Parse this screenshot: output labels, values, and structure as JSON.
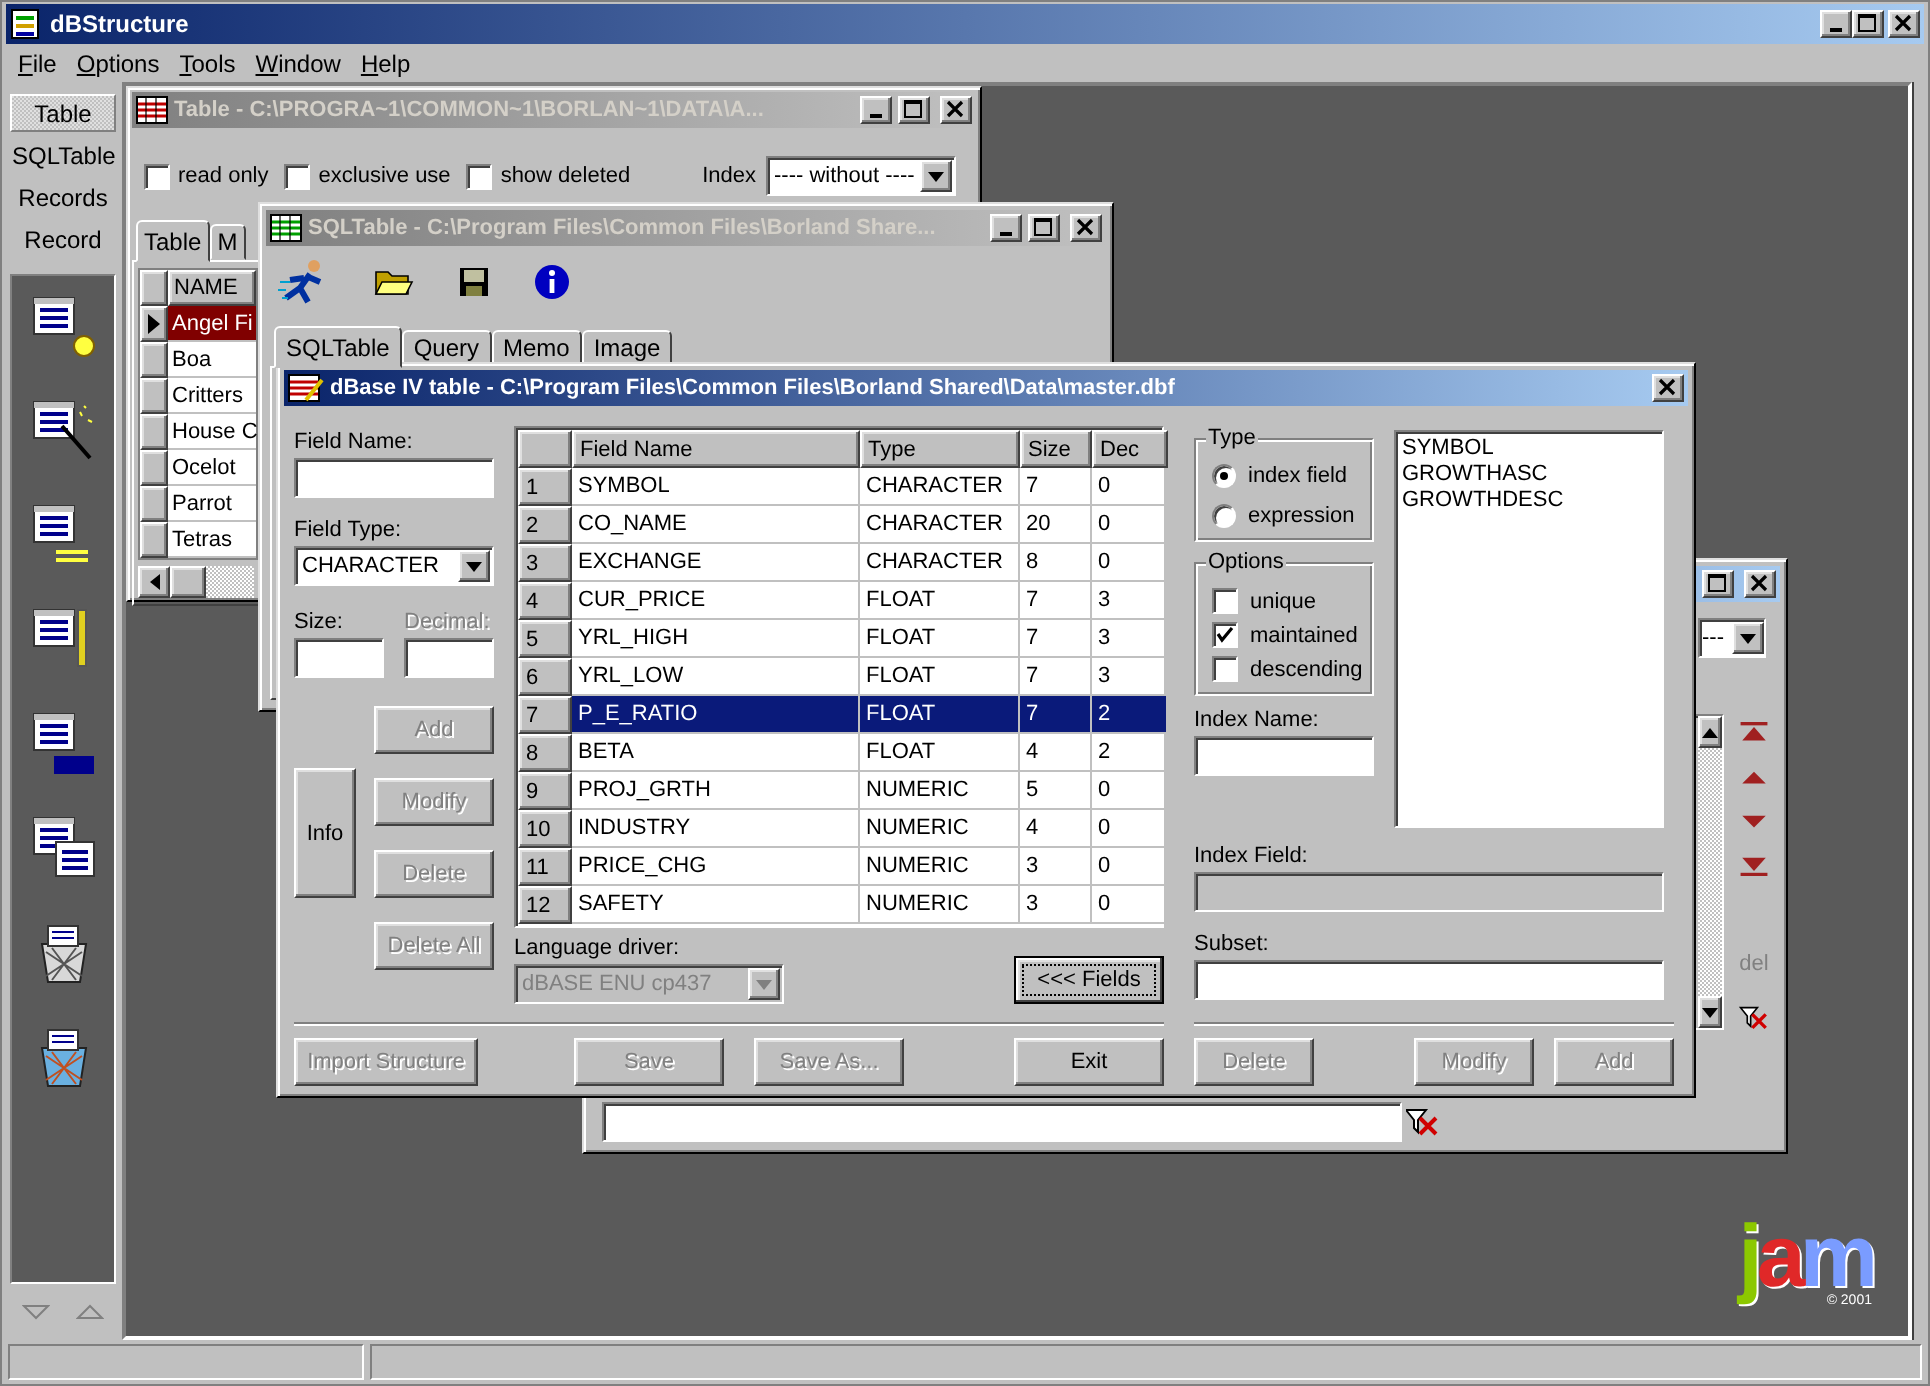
{
  "app": {
    "title": "dBStructure"
  },
  "menu": [
    {
      "label": "File"
    },
    {
      "label": "Options"
    },
    {
      "label": "Tools"
    },
    {
      "label": "Window"
    },
    {
      "label": "Help"
    }
  ],
  "sidebar": {
    "views": [
      {
        "label": "Table",
        "selected": true
      },
      {
        "label": "SQLTable",
        "selected": false
      },
      {
        "label": "Records",
        "selected": false
      },
      {
        "label": "Record",
        "selected": false
      }
    ]
  },
  "table_window": {
    "title": "Table - C:\\PROGRA~1\\COMMON~1\\BORLAN~1\\DATA\\A...",
    "options": [
      {
        "label": "read only",
        "checked": false
      },
      {
        "label": "exclusive use",
        "checked": false
      },
      {
        "label": "show deleted",
        "checked": false
      }
    ],
    "index": {
      "label": "Index",
      "value": "---- without ----"
    },
    "tabs": [
      {
        "label": "Table",
        "selected": true
      },
      {
        "label": "M",
        "selected": false
      }
    ],
    "grid": {
      "column": "NAME",
      "rows": [
        {
          "name": "Angel Fi",
          "selected": true
        },
        {
          "name": "Boa",
          "selected": false
        },
        {
          "name": "Critters",
          "selected": false
        },
        {
          "name": "House C",
          "selected": false
        },
        {
          "name": "Ocelot",
          "selected": false
        },
        {
          "name": "Parrot",
          "selected": false
        },
        {
          "name": "Tetras",
          "selected": false
        }
      ]
    }
  },
  "sql_window": {
    "title": "SQLTable - C:\\Program Files\\Common Files\\Borland Share...",
    "tabs": [
      {
        "label": "SQLTable",
        "selected": true
      },
      {
        "label": "Query",
        "selected": false
      },
      {
        "label": "Memo",
        "selected": false
      },
      {
        "label": "Image",
        "selected": false
      }
    ]
  },
  "back_window": {
    "index_value": "---",
    "delete_label": "del"
  },
  "dialog": {
    "title": "dBase IV table - C:\\Program Files\\Common Files\\Borland Shared\\Data\\master.dbf",
    "field_name": {
      "label": "Field Name:"
    },
    "field_type": {
      "label": "Field Type:",
      "value": "CHARACTER"
    },
    "size": {
      "label": "Size:"
    },
    "decimal": {
      "label": "Decimal:",
      "disabled": true
    },
    "info_button": {
      "label": "Info",
      "disabled": false
    },
    "side_buttons": [
      {
        "label": "Add",
        "disabled": true
      },
      {
        "label": "Modify",
        "disabled": true
      },
      {
        "label": "Delete",
        "disabled": true
      },
      {
        "label": "Delete All",
        "disabled": true
      }
    ],
    "grid": {
      "columns": [
        "Field Name",
        "Type",
        "Size",
        "Dec"
      ],
      "rows": [
        {
          "no": "1",
          "cells": [
            "SYMBOL",
            "CHARACTER",
            "7",
            "0"
          ],
          "selected": false
        },
        {
          "no": "2",
          "cells": [
            "CO_NAME",
            "CHARACTER",
            "20",
            "0"
          ],
          "selected": false
        },
        {
          "no": "3",
          "cells": [
            "EXCHANGE",
            "CHARACTER",
            "8",
            "0"
          ],
          "selected": false
        },
        {
          "no": "4",
          "cells": [
            "CUR_PRICE",
            "FLOAT",
            "7",
            "3"
          ],
          "selected": false
        },
        {
          "no": "5",
          "cells": [
            "YRL_HIGH",
            "FLOAT",
            "7",
            "3"
          ],
          "selected": false
        },
        {
          "no": "6",
          "cells": [
            "YRL_LOW",
            "FLOAT",
            "7",
            "3"
          ],
          "selected": false
        },
        {
          "no": "7",
          "cells": [
            "P_E_RATIO",
            "FLOAT",
            "7",
            "2"
          ],
          "selected": true
        },
        {
          "no": "8",
          "cells": [
            "BETA",
            "FLOAT",
            "4",
            "2"
          ],
          "selected": false
        },
        {
          "no": "9",
          "cells": [
            "PROJ_GRTH",
            "NUMERIC",
            "5",
            "0"
          ],
          "selected": false
        },
        {
          "no": "10",
          "cells": [
            "INDUSTRY",
            "NUMERIC",
            "4",
            "0"
          ],
          "selected": false
        },
        {
          "no": "11",
          "cells": [
            "PRICE_CHG",
            "NUMERIC",
            "3",
            "0"
          ],
          "selected": false
        },
        {
          "no": "12",
          "cells": [
            "SAFETY",
            "NUMERIC",
            "3",
            "0"
          ],
          "selected": false
        }
      ]
    },
    "language_driver": {
      "label": "Language driver:",
      "value": "dBASE ENU cp437",
      "disabled": true
    },
    "fields_button": {
      "label": "<<< Fields"
    },
    "type_group": {
      "title": "Type",
      "options": [
        {
          "label": "index field",
          "selected": true
        },
        {
          "label": "expression",
          "selected": false
        }
      ]
    },
    "options_group": {
      "title": "Options",
      "options": [
        {
          "label": "unique",
          "checked": false
        },
        {
          "label": "maintained",
          "checked": true
        },
        {
          "label": "descending",
          "checked": false
        }
      ]
    },
    "index_list": [
      "SYMBOL",
      "GROWTHASC",
      "GROWTHDESC"
    ],
    "index_name": {
      "label": "Index Name:"
    },
    "index_field": {
      "label": "Index Field:",
      "disabled": true
    },
    "subset": {
      "label": "Subset:"
    },
    "footer_left": [
      {
        "label": "Import Structure",
        "disabled": true
      },
      {
        "label": "Save",
        "disabled": true
      },
      {
        "label": "Save As...",
        "disabled": true
      },
      {
        "label": "Exit",
        "disabled": false
      }
    ],
    "footer_right": [
      {
        "label": "Delete",
        "disabled": true
      },
      {
        "label": "Modify",
        "disabled": true
      },
      {
        "label": "Add",
        "disabled": true
      }
    ]
  },
  "logo": {
    "letters": [
      {
        "char": "j",
        "color": "#8cc800"
      },
      {
        "char": "a",
        "color": "#e02828"
      },
      {
        "char": "m",
        "color": "#7a9cff"
      }
    ],
    "copyright": "© 2001"
  }
}
